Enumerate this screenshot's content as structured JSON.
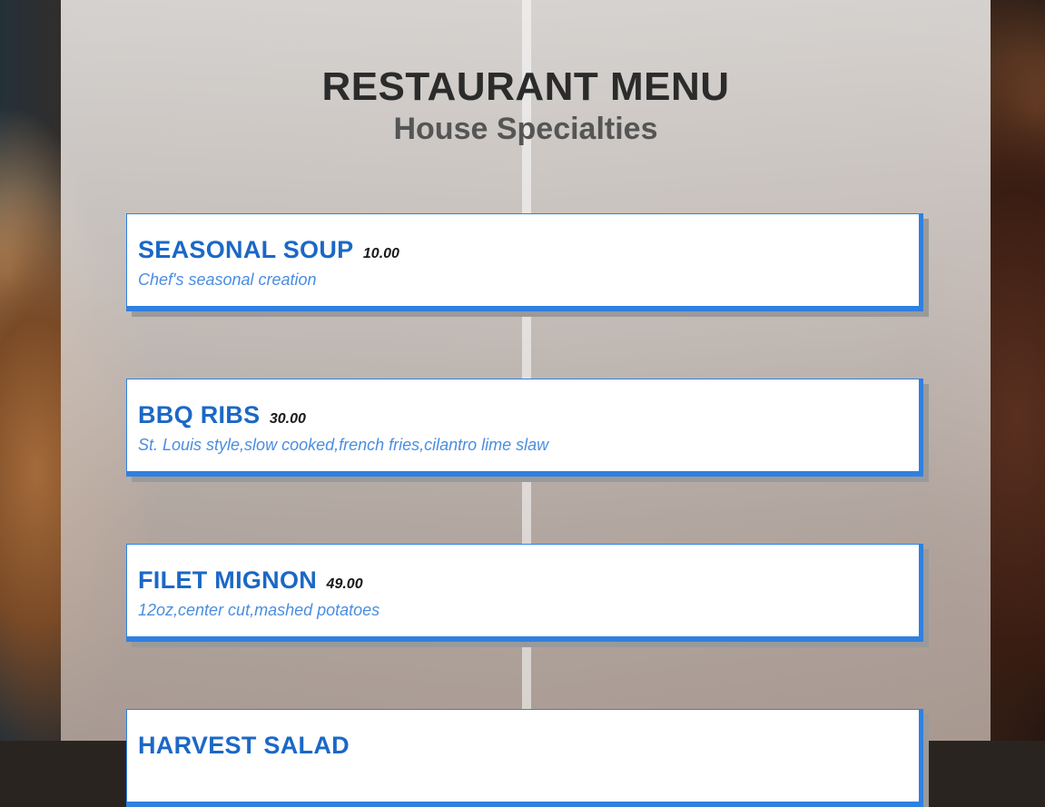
{
  "menu": {
    "title": "RESTAURANT MENU",
    "subtitle": "House Specialties",
    "items": [
      {
        "name": "SEASONAL SOUP",
        "price": "10.00",
        "description": "Chef's seasonal creation"
      },
      {
        "name": "BBQ RIBS",
        "price": "30.00",
        "description": "St. Louis style,slow cooked,french fries,cilantro lime slaw"
      },
      {
        "name": "FILET MIGNON",
        "price": "49.00",
        "description": "12oz,center cut,mashed potatoes"
      },
      {
        "name": "HARVEST SALAD",
        "price": "",
        "description": ""
      }
    ]
  },
  "colors": {
    "item_name": "#1b68c6",
    "item_border": "#2f80e0",
    "item_description": "#4a8de0",
    "title": "#2b2b2b",
    "subtitle": "#555555"
  }
}
